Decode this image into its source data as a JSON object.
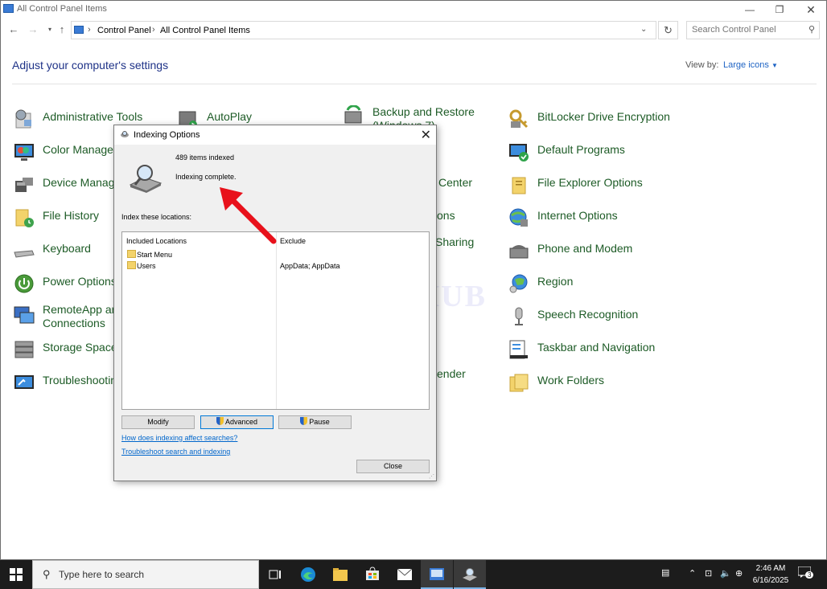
{
  "window": {
    "title": "All Control Panel Items"
  },
  "address": {
    "crumbs": [
      "Control Panel",
      "All Control Panel Items"
    ],
    "search_placeholder": "Search Control Panel"
  },
  "content": {
    "heading": "Adjust your computer's settings",
    "view_by_label": "View by:",
    "view_by_value": "Large icons",
    "items": [
      {
        "label": "Administrative Tools"
      },
      {
        "label": "AutoPlay"
      },
      {
        "label": "Backup and Restore (Windows 7)"
      },
      {
        "label": "BitLocker Drive Encryption"
      },
      {
        "label": "Color Management"
      },
      {
        "label": "Default Programs"
      },
      {
        "label": "Device Manager"
      },
      {
        "label": "Center"
      },
      {
        "label": "File Explorer Options"
      },
      {
        "label": "File History"
      },
      {
        "label": "ons"
      },
      {
        "label": "Internet Options"
      },
      {
        "label": "Keyboard"
      },
      {
        "label": "Sharing"
      },
      {
        "label": "Phone and Modem"
      },
      {
        "label": "Power Options"
      },
      {
        "label": "Region"
      },
      {
        "label": "RemoteApp and Desktop Connections"
      },
      {
        "label": "Speech Recognition"
      },
      {
        "label": "Storage Spaces"
      },
      {
        "label": "Taskbar and Navigation"
      },
      {
        "label": "Troubleshooting"
      },
      {
        "label": "ender"
      },
      {
        "label": "Work Folders"
      }
    ]
  },
  "dialog": {
    "title": "Indexing Options",
    "items_indexed": "489 items indexed",
    "status": "Indexing complete.",
    "index_label": "Index these locations:",
    "included_header": "Included Locations",
    "exclude_header": "Exclude",
    "locations": [
      {
        "name": "Start Menu",
        "exclude": ""
      },
      {
        "name": "Users",
        "exclude": "AppData; AppData"
      }
    ],
    "modify_label": "Modify",
    "advanced_label": "Advanced",
    "pause_label": "Pause",
    "link1": "How does indexing affect searches?",
    "link2": "Troubleshoot search and indexing",
    "close_label": "Close"
  },
  "watermark": "IT Pros HUB",
  "taskbar": {
    "search_placeholder": "Type here to search",
    "time": "2:46 AM",
    "date": "6/16/2025",
    "notification_count": "3"
  },
  "colors": {
    "link_green": "#1d5b26",
    "heading_blue": "#1e3287",
    "arrow_red": "#e8111b",
    "taskbar": "#1c1c1c"
  }
}
